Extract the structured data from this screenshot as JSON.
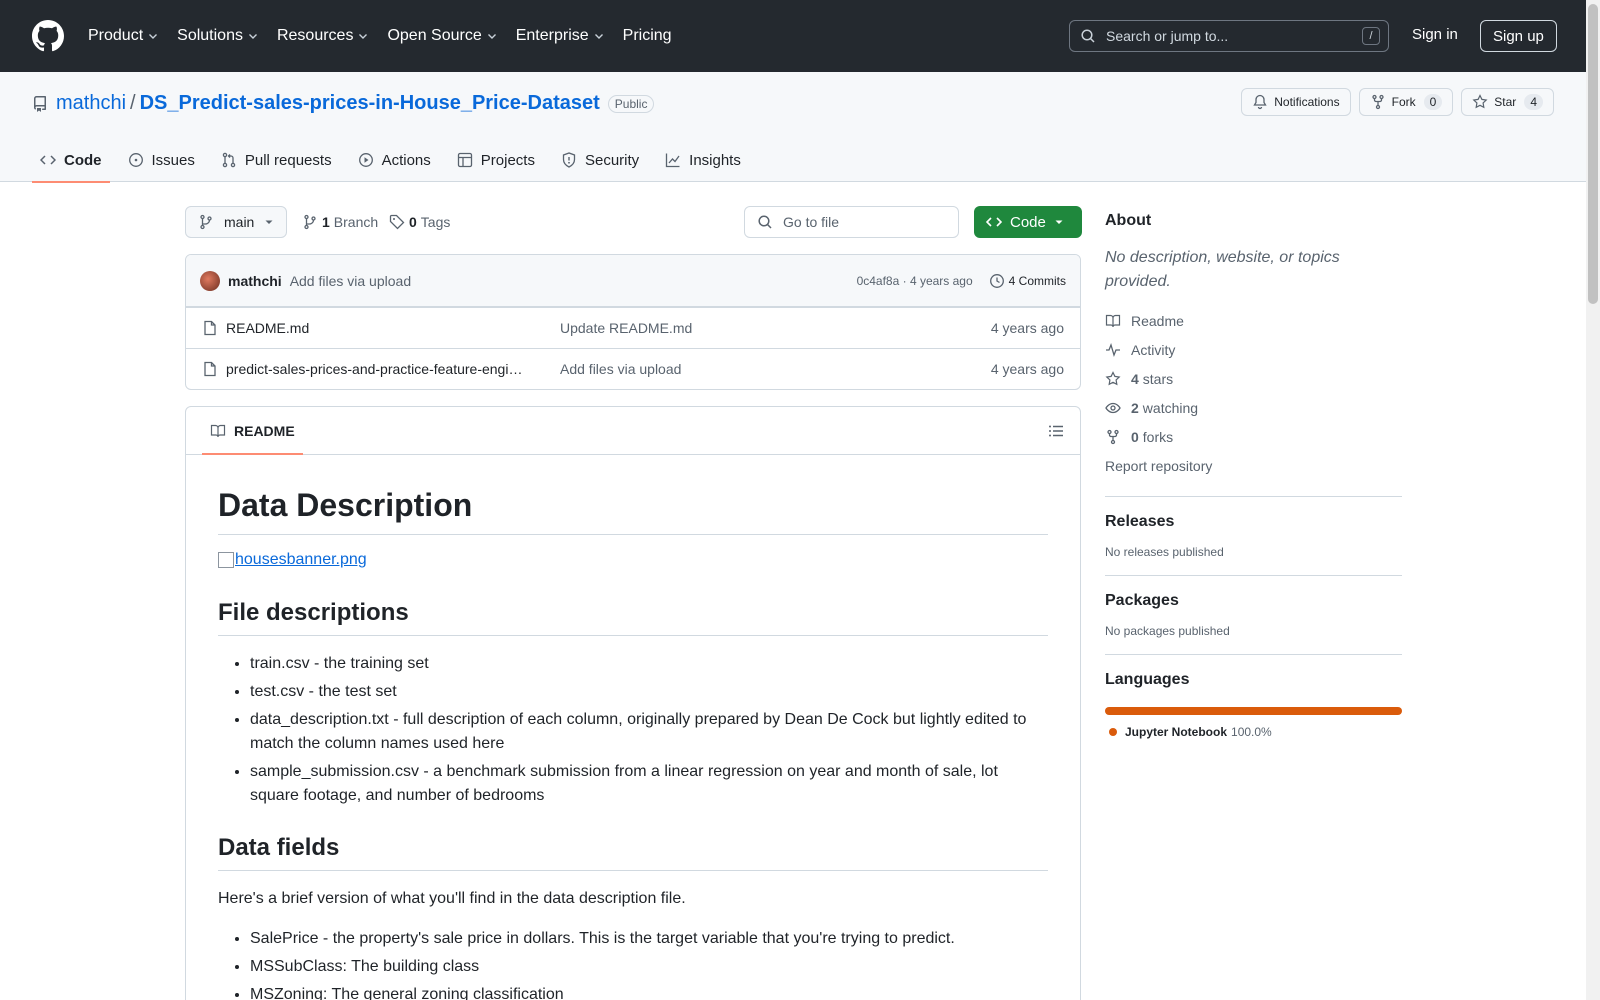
{
  "header": {
    "nav": [
      "Product",
      "Solutions",
      "Resources",
      "Open Source",
      "Enterprise",
      "Pricing"
    ],
    "search_placeholder": "Search or jump to...",
    "search_shortcut": "/",
    "signin": "Sign in",
    "signup": "Sign up"
  },
  "repo": {
    "owner": "mathchi",
    "name": "DS_Predict-sales-prices-in-House_Price-Dataset",
    "visibility": "Public",
    "notifications_label": "Notifications",
    "fork_label": "Fork",
    "fork_count": "0",
    "star_label": "Star",
    "star_count": "4"
  },
  "tabs": [
    "Code",
    "Issues",
    "Pull requests",
    "Actions",
    "Projects",
    "Security",
    "Insights"
  ],
  "toolbar": {
    "branch": "main",
    "branch_count": "1",
    "branch_label": "Branch",
    "tag_count": "0",
    "tag_label": "Tags",
    "goto_placeholder": "Go to file",
    "code_label": "Code"
  },
  "commit": {
    "author": "mathchi",
    "message": "Add files via upload",
    "hash": "0c4af8a",
    "age": "4 years ago",
    "commits_label": "4 Commits"
  },
  "files": [
    {
      "name": "README.md",
      "message": "Update README.md",
      "date": "4 years ago"
    },
    {
      "name": "predict-sales-prices-and-practice-feature-engi…",
      "message": "Add files via upload",
      "date": "4 years ago"
    }
  ],
  "readme": {
    "tab_label": "README",
    "h1": "Data Description",
    "banner": "housesbanner.png",
    "h2_files": "File descriptions",
    "file_items": [
      "train.csv - the training set",
      "test.csv - the test set",
      "data_description.txt - full description of each column, originally prepared by Dean De Cock but lightly edited to match the column names used here",
      "sample_submission.csv - a benchmark submission from a linear regression on year and month of sale, lot square footage, and number of bedrooms"
    ],
    "h2_fields": "Data fields",
    "fields_intro": "Here's a brief version of what you'll find in the data description file.",
    "field_items": [
      "SalePrice - the property's sale price in dollars. This is the target variable that you're trying to predict.",
      "MSSubClass: The building class",
      "MSZoning: The general zoning classification"
    ]
  },
  "about": {
    "title": "About",
    "description": "No description, website, or topics provided.",
    "readme": "Readme",
    "activity": "Activity",
    "stars_count": "4",
    "stars_label": "stars",
    "watching_count": "2",
    "watching_label": "watching",
    "forks_count": "0",
    "forks_label": "forks",
    "report": "Report repository"
  },
  "releases": {
    "title": "Releases",
    "text": "No releases published"
  },
  "packages": {
    "title": "Packages",
    "text": "No packages published"
  },
  "languages": {
    "title": "Languages",
    "items": [
      {
        "name": "Jupyter Notebook",
        "percent": "100.0%",
        "color": "#DA5B0B"
      }
    ]
  },
  "colors": {
    "accent": "#0969da",
    "green": "#1f883d",
    "tab_underline": "#fd8c73"
  }
}
